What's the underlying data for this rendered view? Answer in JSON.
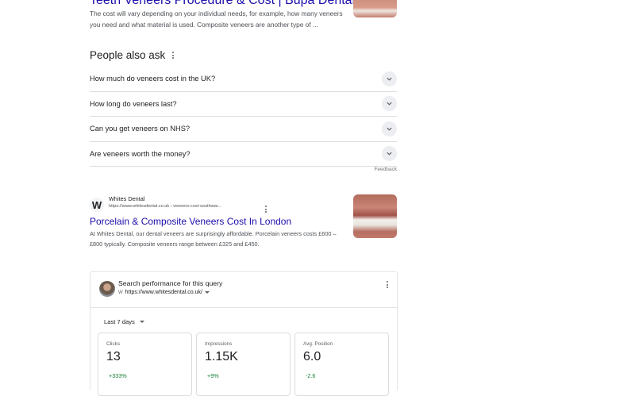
{
  "top_result": {
    "title": "Teeth Veneers Procedure & Cost | Bupa Dental Care",
    "snippet": "The cost will vary depending on your individual needs, for example, how many veneers you need and what material is used. Composite veneers are another type of ..."
  },
  "people_also_ask": {
    "heading": "People also ask",
    "questions": [
      "How much do veneers cost in the UK?",
      "How long do veneers last?",
      "Can you get veneers on NHS?",
      "Are veneers worth the money?"
    ],
    "feedback": "Feedback"
  },
  "result": {
    "logo_letter": "W",
    "site_name": "Whites Dental",
    "url": "https://www.whitesdental.co.uk › veneers-cost-southwar...",
    "title": "Porcelain & Composite Veneers Cost In London",
    "snippet": "At Whites Dental, our dental veneers are surprisingly affordable. Porcelain veneers costs £600 – £800 typically. Composite veneers range between £325 and £450."
  },
  "performance": {
    "title": "Search performance for this query",
    "site_icon_letter": "W",
    "site": "https://www.whitesdental.co.uk/",
    "range": "Last 7 days",
    "metrics": [
      {
        "label": "Clicks",
        "value": "13",
        "delta": "+333%"
      },
      {
        "label": "Impressions",
        "value": "1.15K",
        "delta": "+9%"
      },
      {
        "label": "Avg. Position",
        "value": "6.0",
        "delta": "-2.6"
      }
    ]
  },
  "colors": {
    "link": "#1a0dab",
    "positive": "#188038"
  }
}
